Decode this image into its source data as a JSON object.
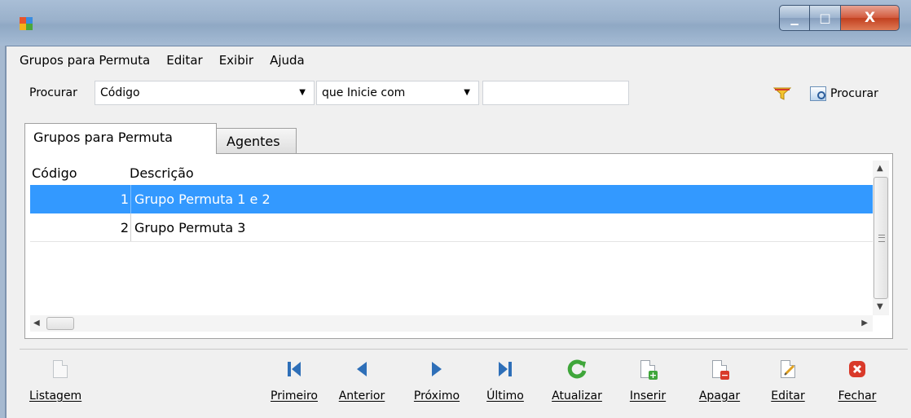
{
  "window": {
    "minimize_glyph": "▁",
    "maximize_glyph": "□",
    "close_glyph": "X",
    "icons": [
      "app-icon",
      "minimize-icon",
      "maximize-icon",
      "close-icon"
    ]
  },
  "menu": {
    "items": [
      {
        "label": "Grupos para Permuta"
      },
      {
        "label": "Editar"
      },
      {
        "label": "Exibir"
      },
      {
        "label": "Ajuda"
      }
    ]
  },
  "search": {
    "label": "Procurar",
    "field_value": "Código",
    "operator_value": "que Inicie com",
    "term_value": "",
    "button_label": "Procurar",
    "icons": [
      "filter-icon",
      "search-window-icon"
    ]
  },
  "tabs": [
    {
      "label": "Grupos para Permuta",
      "active": true
    },
    {
      "label": "Agentes",
      "active": false
    }
  ],
  "grid": {
    "columns": [
      "Código",
      "Descrição"
    ],
    "rows": [
      {
        "codigo": "1",
        "descricao": "Grupo Permuta 1 e 2",
        "selected": true
      },
      {
        "codigo": "2",
        "descricao": "Grupo Permuta 3",
        "selected": false
      }
    ],
    "selection_color": "#3399ff"
  },
  "toolbar": {
    "listagem": "Listagem",
    "primeiro": "Primeiro",
    "anterior": "Anterior",
    "proximo": "Próximo",
    "ultimo": "Último",
    "atualizar": "Atualizar",
    "inserir": "Inserir",
    "apagar": "Apagar",
    "editar": "Editar",
    "fechar": "Fechar",
    "nav_color": "#2e6fb8",
    "refresh_color": "#3fa63a",
    "close_color": "#d93a2a"
  }
}
